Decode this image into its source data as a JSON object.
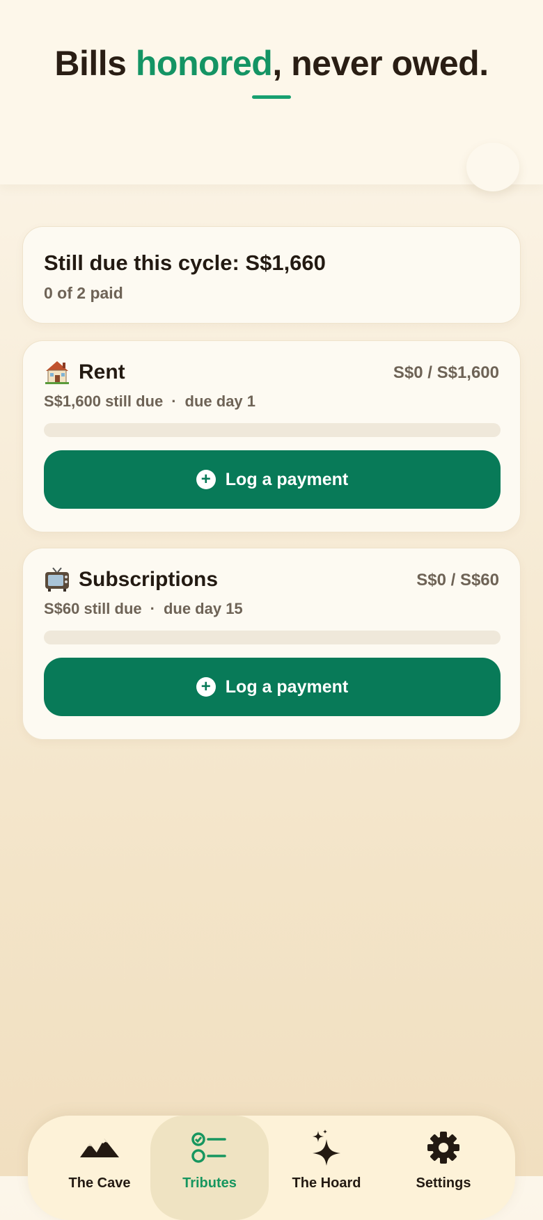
{
  "header": {
    "headline_before": "Bills ",
    "headline_accent": "honored",
    "headline_after": ", never owed.",
    "accent_color": "#149464"
  },
  "summary": {
    "title": "Still due this cycle: S$1,660",
    "subtitle": "0 of 2 paid"
  },
  "bills": [
    {
      "icon": "house-icon",
      "name": "Rent",
      "amount": "S$0 / S$1,600",
      "still_due": "S$1,600 still due",
      "separator": "·",
      "due_day": "due day 1",
      "progress_fraction": 0,
      "button_label": "Log a payment"
    },
    {
      "icon": "television-icon",
      "name": "Subscriptions",
      "amount": "S$0 / S$60",
      "still_due": "S$60 still due",
      "separator": "·",
      "due_day": "due day 15",
      "progress_fraction": 0,
      "button_label": "Log a payment"
    }
  ],
  "tabbar": {
    "tabs": [
      {
        "label": "The Cave",
        "icon": "mountains-icon",
        "active": false
      },
      {
        "label": "Tributes",
        "icon": "checklist-icon",
        "active": true
      },
      {
        "label": "The Hoard",
        "icon": "sparkles-icon",
        "active": false
      },
      {
        "label": "Settings",
        "icon": "gear-icon",
        "active": false
      }
    ]
  },
  "colors": {
    "primary_button": "#087a58",
    "active_tab_label": "#17965f",
    "background": "#f8eedb"
  }
}
